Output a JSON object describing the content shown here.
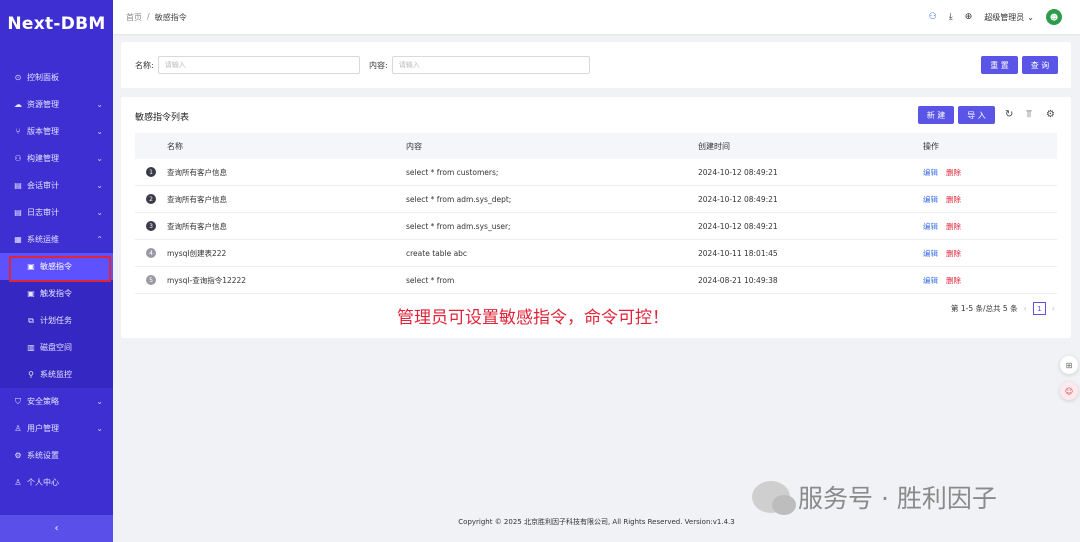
{
  "app": {
    "logo": "Next-DBM"
  },
  "sidebar": {
    "items": [
      {
        "label": "控制面板",
        "icon": "dashboard-icon",
        "glyph": "⊙",
        "chevron": ""
      },
      {
        "label": "资源管理",
        "icon": "cloud-icon",
        "glyph": "☁",
        "chevron": "⌄"
      },
      {
        "label": "版本管理",
        "icon": "branch-icon",
        "glyph": "⑂",
        "chevron": "⌄"
      },
      {
        "label": "构建管理",
        "icon": "build-icon",
        "glyph": "⚇",
        "chevron": "⌄"
      },
      {
        "label": "会话审计",
        "icon": "audit-icon",
        "glyph": "▤",
        "chevron": "⌄"
      },
      {
        "label": "日志审计",
        "icon": "log-icon",
        "glyph": "▤",
        "chevron": "⌄"
      },
      {
        "label": "系统运维",
        "icon": "ops-icon",
        "glyph": "▦",
        "chevron": "⌃"
      }
    ],
    "submenu": [
      {
        "label": "敏感指令",
        "icon": "command-icon",
        "glyph": "▣"
      },
      {
        "label": "触发指令",
        "icon": "trigger-icon",
        "glyph": "▣"
      },
      {
        "label": "计划任务",
        "icon": "task-icon",
        "glyph": "⧉"
      },
      {
        "label": "磁盘空间",
        "icon": "disk-icon",
        "glyph": "▥"
      },
      {
        "label": "系统监控",
        "icon": "monitor-icon",
        "glyph": "⚲"
      }
    ],
    "items_after": [
      {
        "label": "安全策略",
        "icon": "shield-icon",
        "glyph": "⛉",
        "chevron": "⌄"
      },
      {
        "label": "用户管理",
        "icon": "user-icon",
        "glyph": "♙",
        "chevron": "⌄"
      },
      {
        "label": "系统设置",
        "icon": "gear-icon",
        "glyph": "⚙",
        "chevron": ""
      },
      {
        "label": "个人中心",
        "icon": "person-icon",
        "glyph": "♙",
        "chevron": ""
      }
    ],
    "collapse_glyph": "‹"
  },
  "header": {
    "breadcrumb_home": "首页",
    "breadcrumb_sep": "/",
    "breadcrumb_current": "敏感指令",
    "user_name": "超级管理员",
    "user_chevron": "⌄",
    "icons": [
      "sitemap-icon",
      "download-icon",
      "globe-icon"
    ]
  },
  "search": {
    "name_label": "名称:",
    "name_placeholder": "请输入",
    "content_label": "内容:",
    "content_placeholder": "请输入",
    "reset_label": "重 置",
    "query_label": "查 询"
  },
  "list": {
    "title": "敏感指令列表",
    "new_label": "新 建",
    "import_label": "导 入",
    "columns": {
      "name": "名称",
      "content": "内容",
      "time": "创建时间",
      "ops": "操作"
    },
    "rows": [
      {
        "idx": "1",
        "name": "查询所有客户信息",
        "content": "select * from customers;",
        "time": "2024-10-12 08:49:21",
        "edit": "编辑",
        "del": "删除"
      },
      {
        "idx": "2",
        "name": "查询所有客户信息",
        "content": "select * from adm.sys_dept;",
        "time": "2024-10-12 08:49:21",
        "edit": "编辑",
        "del": "删除"
      },
      {
        "idx": "3",
        "name": "查询所有客户信息",
        "content": "select * from adm.sys_user;",
        "time": "2024-10-12 08:49:21",
        "edit": "编辑",
        "del": "删除"
      },
      {
        "idx": "4",
        "name": "mysql创建表222",
        "content": "create table abc",
        "time": "2024-10-11 18:01:45",
        "edit": "编辑",
        "del": "删除"
      },
      {
        "idx": "5",
        "name": "mysql-查询指令12222",
        "content": "select * from",
        "time": "2024-08-21 10:49:38",
        "edit": "编辑",
        "del": "删除"
      }
    ],
    "pagination": {
      "summary": "第 1-5 条/总共 5 条",
      "current_page": "1",
      "prev": "‹",
      "next": "›"
    }
  },
  "annotation": "管理员可设置敏感指令，命令可控！",
  "watermark": "服务号 · 胜利因子",
  "footer": "Copyright © 2025 北京胜利因子科技有限公司, All Rights Reserved. Version:v1.4.3",
  "colors": {
    "sidebar": "#3d2fd1",
    "primary": "#5a55e6",
    "danger": "#e0253a",
    "link": "#3d72e8"
  }
}
